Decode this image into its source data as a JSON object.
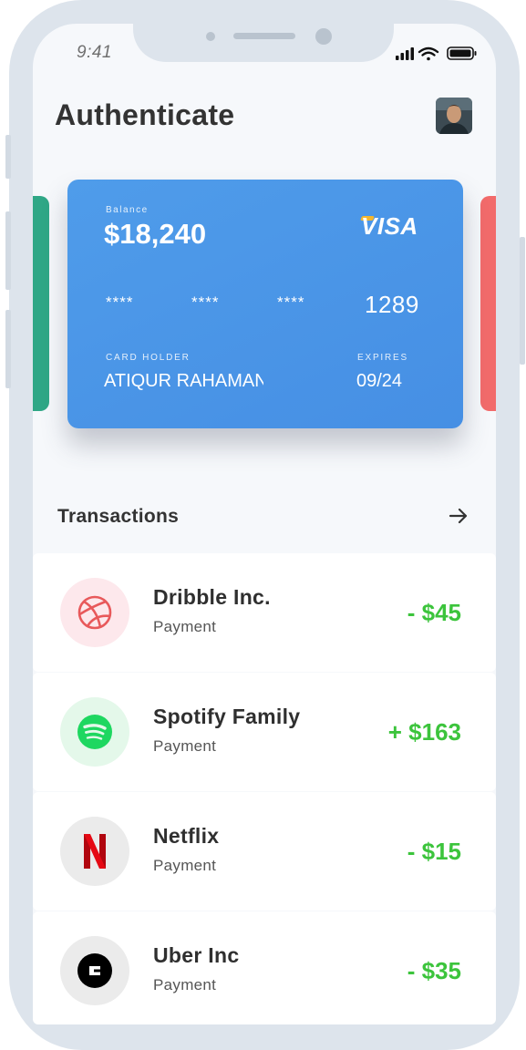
{
  "status_bar": {
    "time": "9:41"
  },
  "header": {
    "title": "Authenticate"
  },
  "card": {
    "balance_label": "Balance",
    "balance": "$18,240",
    "brand": "VISA",
    "mask_groups": [
      "****",
      "****",
      "****"
    ],
    "last4": "1289",
    "holder_label": "CARD HOLDER",
    "holder": "ATIQUR RAHAMAN",
    "expires_label": "EXPIRES",
    "expires": "09/24",
    "color": "#4a94e6"
  },
  "transactions": {
    "title": "Transactions",
    "items": [
      {
        "name": "Dribble Inc.",
        "type": "Payment",
        "amount": "- $45",
        "icon": "dribbble-icon",
        "icon_bg": "#fde8ec"
      },
      {
        "name": "Spotify Family",
        "type": "Payment",
        "amount": "+ $163",
        "icon": "spotify-icon",
        "icon_bg": "#e4f8ea"
      },
      {
        "name": "Netflix",
        "type": "Payment",
        "amount": "- $15",
        "icon": "netflix-icon",
        "icon_bg": "#ebebeb"
      },
      {
        "name": "Uber Inc",
        "type": "Payment",
        "amount": "- $35",
        "icon": "uber-icon",
        "icon_bg": "#ebebeb"
      }
    ]
  },
  "colors": {
    "positive": "#3cc43c",
    "left_card": "#2fa786",
    "right_card": "#f26b6b"
  }
}
